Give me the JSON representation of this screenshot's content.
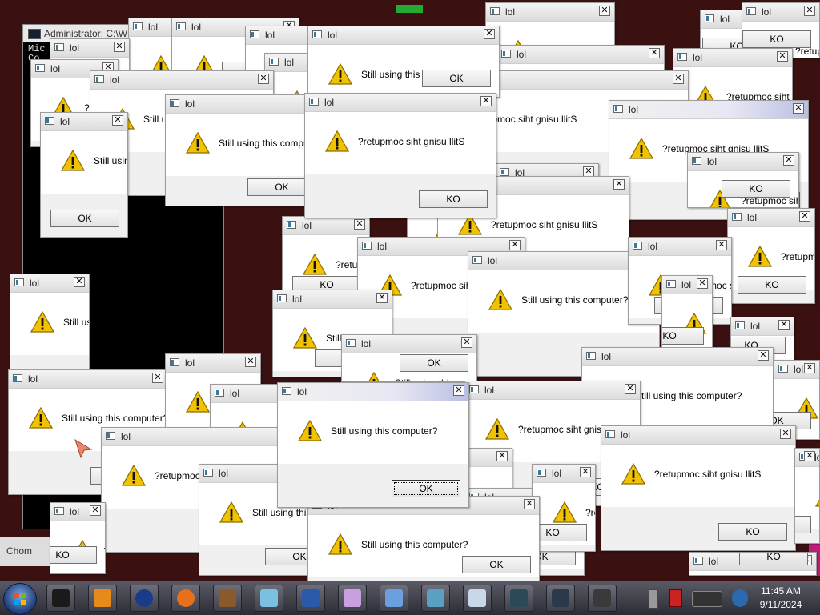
{
  "console": {
    "title": "Administrator: C:\\W",
    "lines": [
      "Mic",
      "Co"
    ]
  },
  "bg_chrome_label": "Chom",
  "dialogs": [
    {
      "title": "lol",
      "message": "Still using this computer?",
      "button": "OK"
    },
    {
      "title": "lol",
      "message": "?retupmoc siht gnisu llitS",
      "button": "KO"
    }
  ],
  "colors": {
    "warning": "#f2c200",
    "active_title": "#b9bfe2",
    "desktop": "#3a1010"
  },
  "taskbar": {
    "items": [
      "start-orb-icon",
      "terminal-icon",
      "media-player-icon",
      "globe-icon",
      "firefox-icon",
      "virtualbox-icon",
      "notepad-icon",
      "tablet-icon",
      "paint-icon",
      "wordpad-icon",
      "cube-icon",
      "calculator-icon",
      "monitor-graph-icon",
      "screen-icon",
      "display-icon"
    ],
    "clock": {
      "time": "11:45 AM",
      "date": "9/11/2024"
    }
  }
}
